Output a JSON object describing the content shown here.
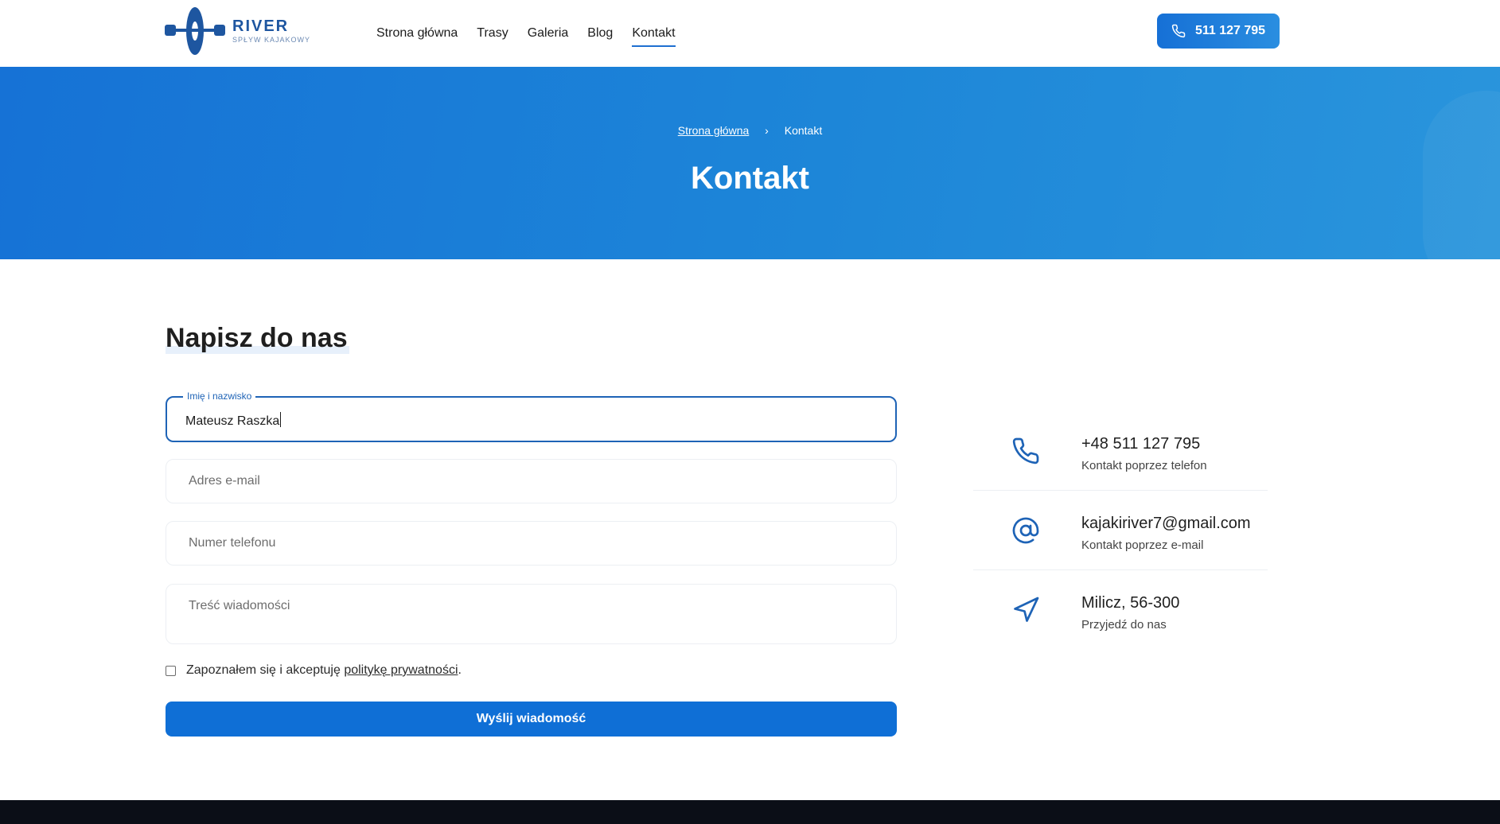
{
  "brand": {
    "title": "RIVER",
    "subtitle": "SPŁYW KAJAKOWY",
    "primary_color": "#1e56a0",
    "accent_color": "#1670d6"
  },
  "nav": {
    "items": [
      {
        "label": "Strona główna",
        "active": false
      },
      {
        "label": "Trasy",
        "active": false
      },
      {
        "label": "Galeria",
        "active": false
      },
      {
        "label": "Blog",
        "active": false
      },
      {
        "label": "Kontakt",
        "active": true
      }
    ],
    "phone_button": {
      "label": "511 127 795",
      "icon": "phone-icon"
    }
  },
  "hero": {
    "breadcrumb": {
      "home": "Strona główna",
      "separator": "›",
      "current": "Kontakt"
    },
    "title": "Kontakt"
  },
  "form": {
    "title": "Napisz do nas",
    "name": {
      "label": "Imię i nazwisko",
      "value": "Mateusz Raszka"
    },
    "email": {
      "placeholder": "Adres e-mail"
    },
    "phone": {
      "placeholder": "Numer telefonu"
    },
    "message": {
      "placeholder": "Treść wiadomości"
    },
    "consent": {
      "text_before": "Zapoznałem się i akceptuję ",
      "link": "politykę prywatności",
      "text_after": "."
    },
    "submit_label": "Wyślij wiadomość"
  },
  "contact_info": [
    {
      "main": "+48 511 127 795",
      "sub": "Kontakt poprzez telefon",
      "icon": "phone-icon"
    },
    {
      "main": "kajakiriver7@gmail.com",
      "sub": "Kontakt poprzez e-mail",
      "icon": "at-sign-icon"
    },
    {
      "main": "Milicz, 56-300",
      "sub": "Przyjedź do nas",
      "icon": "navigation-arrow-icon"
    }
  ]
}
